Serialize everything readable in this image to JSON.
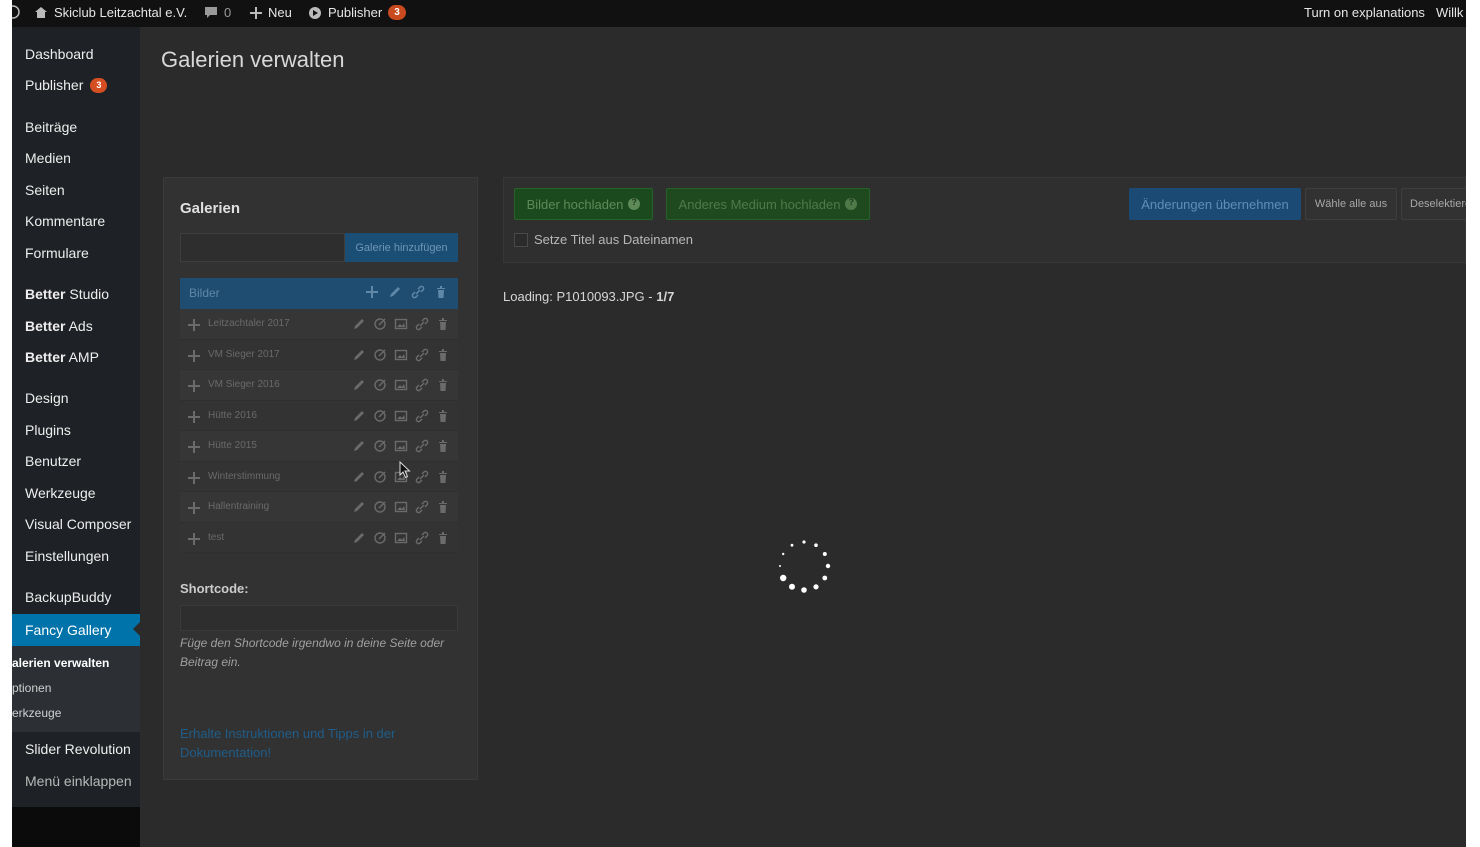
{
  "adminbar": {
    "site_name": "Skiclub Leitzachtal e.V.",
    "comments_count": "0",
    "new_label": "Neu",
    "publisher_label": "Publisher",
    "publisher_badge": "3",
    "explanations_label": "Turn on explanations",
    "greeting": "Willk"
  },
  "sidebar": {
    "items": [
      {
        "label": "Dashboard"
      },
      {
        "label": "Publisher",
        "badge": "3"
      },
      {
        "label": "Beiträge"
      },
      {
        "label": "Medien"
      },
      {
        "label": "Seiten"
      },
      {
        "label": "Kommentare"
      },
      {
        "label": "Formulare"
      },
      {
        "label_strong": "Better",
        "label_rest": " Studio"
      },
      {
        "label_strong": "Better",
        "label_rest": " Ads"
      },
      {
        "label_strong": "Better",
        "label_rest": " AMP"
      },
      {
        "label": "Design"
      },
      {
        "label": "Plugins"
      },
      {
        "label": "Benutzer"
      },
      {
        "label": "Werkzeuge"
      },
      {
        "label": "Visual Composer"
      },
      {
        "label": "Einstellungen"
      },
      {
        "label": "BackupBuddy"
      },
      {
        "label": "Fancy Gallery"
      },
      {
        "label": "Slider Revolution"
      },
      {
        "label": "Menü einklappen"
      }
    ],
    "submenu": [
      {
        "label": "alerien verwalten"
      },
      {
        "label": "ptionen"
      },
      {
        "label": "erkzeuge"
      }
    ]
  },
  "page": {
    "title": "Galerien verwalten"
  },
  "galleries": {
    "heading": "Galerien",
    "name_input_value": "",
    "add_button": "Galerie hinzufügen",
    "list_header": "Bilder",
    "rows": [
      {
        "label": "Leitzachtaler 2017"
      },
      {
        "label": "VM Sieger 2017"
      },
      {
        "label": "VM Sieger 2016"
      },
      {
        "label": "Hütte 2016"
      },
      {
        "label": "Hütte 2015"
      },
      {
        "label": "Winterstimmung"
      },
      {
        "label": "Hallentraining"
      },
      {
        "label": "test"
      }
    ],
    "shortcode_label": "Shortcode:",
    "shortcode_hint": "Füge den Shortcode irgendwo in deine Seite oder Beitrag ein.",
    "docs_link": "Erhalte Instruktionen und Tipps in der Dokumentation!"
  },
  "toolbar": {
    "upload_images": "Bilder hochladen",
    "upload_other": "Anderes Medium hochladen",
    "apply_changes": "Änderungen übernehmen",
    "select_all": "Wähle alle aus",
    "deselect": "Deselektieren",
    "title_from_filename": "Setze Titel aus Dateinamen"
  },
  "loading": {
    "prefix": "Loading: P1010093.JPG - ",
    "progress": "1/7"
  },
  "colors": {
    "accent_blue": "#0073aa",
    "badge_orange": "#d54e21",
    "upload_green": "#1c4a1f",
    "apply_blue": "#1b4b75"
  }
}
